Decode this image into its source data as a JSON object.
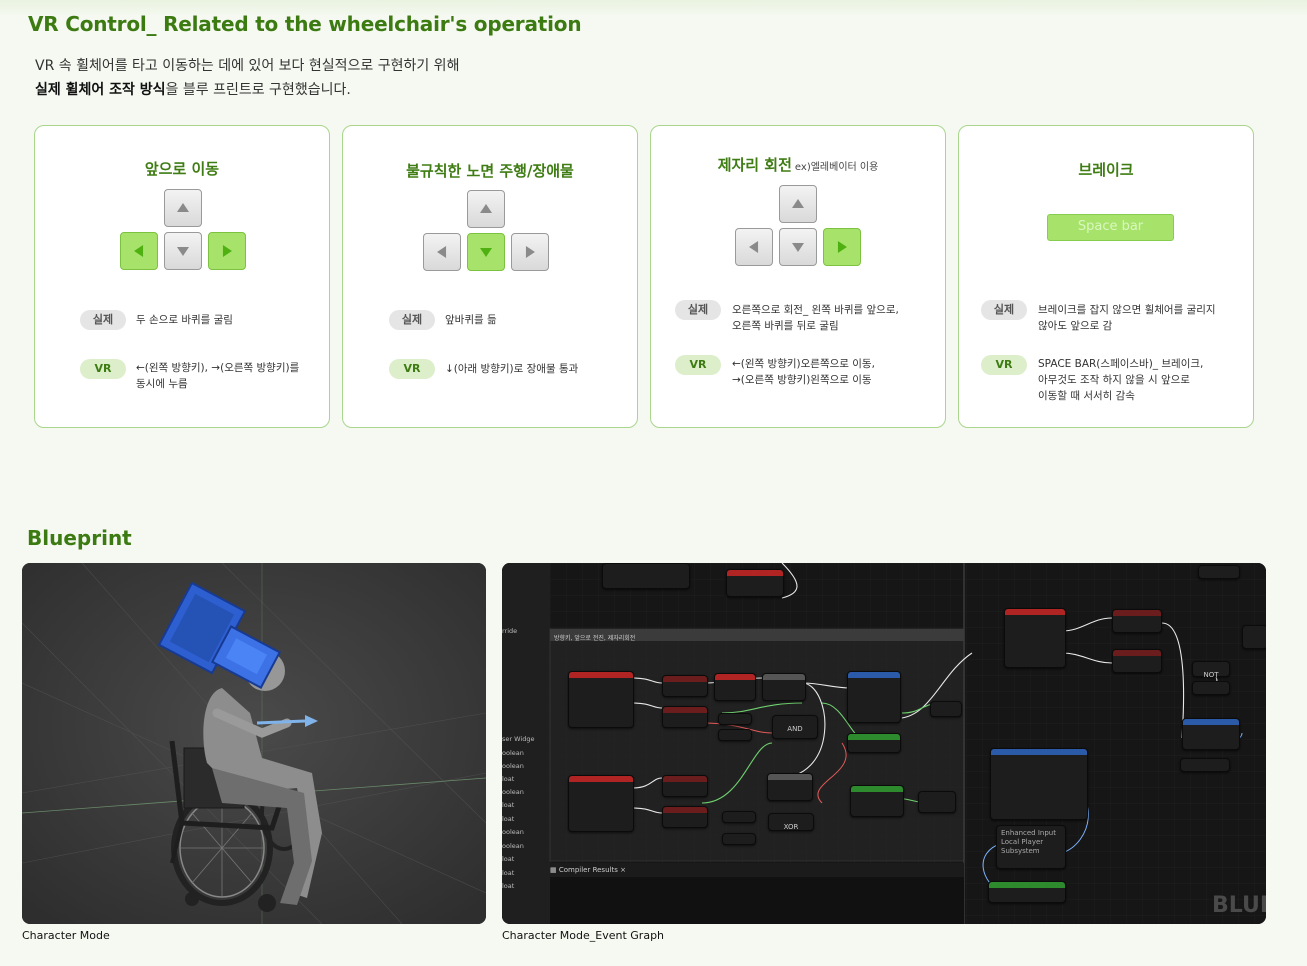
{
  "header": {
    "title": "VR Control_ Related to the wheelchair's operation",
    "intro_line1": "VR 속 휠체어를 타고 이동하는 데에 있어 보다 현실적으로 구현하기 위해",
    "intro_line2_bold": "실제 휠체어 조작 방식",
    "intro_line2_rest": "을 블루 프린트로 구현했습니다."
  },
  "cards": [
    {
      "title": "앞으로 이동",
      "real_label": "실제",
      "real_text": "두 손으로 바퀴를 굴림",
      "vr_label": "VR",
      "vr_text_1": "←(왼쪽 방향키), →(오른쪽 방향키)를",
      "vr_text_2": "동시에 누름"
    },
    {
      "title": "불규칙한 노면 주행/장애물",
      "real_label": "실제",
      "real_text": "앞바퀴를 듦",
      "vr_label": "VR",
      "vr_text_1": "↓(아래 방향키)로 장애물 통과"
    },
    {
      "title": "제자리 회전",
      "title_extra": "ex)엘레베이터 이용",
      "real_label": "실제",
      "real_text_1": "오른쪽으로 회전_ 왼쪽 바퀴를 앞으로,",
      "real_text_2": "오른쪽 바퀴를 뒤로 굴림",
      "vr_label": "VR",
      "vr_text_1": "←(왼쪽 방향키)오른쪽으로 이동,",
      "vr_text_2": "→(오른쪽 방향키)왼쪽으로 이동"
    },
    {
      "title": "브레이크",
      "key_label": "Space bar",
      "real_label": "실제",
      "real_text_1": "브레이크를 잡지 않으면 휠체어를 굴리지",
      "real_text_2": "않아도 앞으로 감",
      "vr_label": "VR",
      "vr_text_1": "SPACE BAR(스페이스바)_ 브레이크,",
      "vr_text_2": "아무것도 조작 하지 않을 시 앞으로",
      "vr_text_3": "이동할 때 서서히 감속"
    }
  ],
  "blueprint": {
    "section_title": "Blueprint",
    "left_caption": "Character Mode",
    "right_caption": "Character Mode_Event Graph",
    "graph": {
      "comment": "방향키, 앞으로 전진, 제자리회전",
      "compiler_tab": "Compiler Results",
      "panel_rows": [
        "ser Widge",
        "oolean",
        "oolean",
        "loat",
        "oolean",
        "loat",
        "loat",
        "oolean",
        "oolean",
        "loat",
        "loat",
        "loat"
      ],
      "node_and": "AND",
      "node_xor": "XOR",
      "node_not": "NOT",
      "node_enhanced": "Enhanced Input Local Player Subsystem",
      "watermark": "BLUE",
      "override": "rride"
    }
  },
  "colors": {
    "accent_green": "#3c7a12",
    "key_active": "#a7e36b",
    "card_border": "#a9d58c"
  }
}
